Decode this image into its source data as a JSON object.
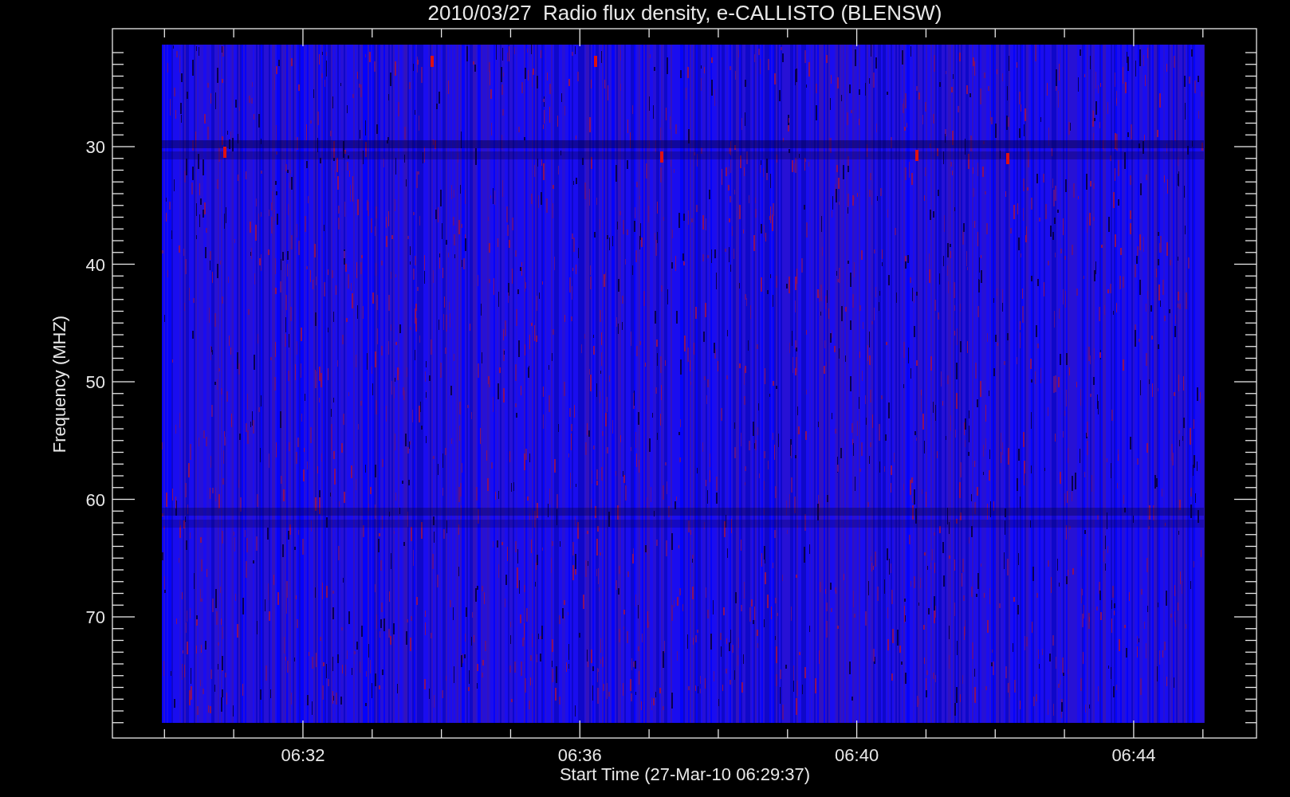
{
  "title": "2010/03/27  Radio flux density, e-CALLISTO (BLENSW)",
  "y_axis": {
    "label": "Frequency (MHZ)",
    "ticks": [
      "30",
      "40",
      "50",
      "60",
      "70"
    ]
  },
  "x_axis": {
    "label": "Start Time (27-Mar-10 06:29:37)",
    "ticks": [
      "06:32",
      "06:36",
      "06:40",
      "06:44"
    ]
  }
}
